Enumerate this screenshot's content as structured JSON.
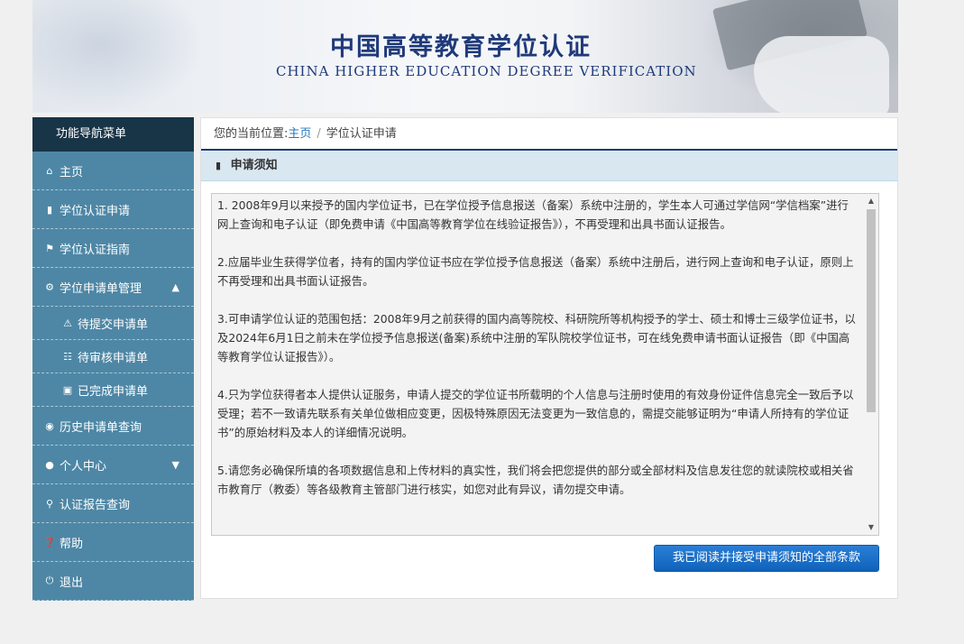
{
  "banner": {
    "title": "中国高等教育学位认证",
    "subtitle": "CHINA HIGHER EDUCATION DEGREE VERIFICATION"
  },
  "sidebar": {
    "header": "功能导航菜单",
    "items": [
      {
        "label": "主页",
        "icon": "home-icon"
      },
      {
        "label": "学位认证申请",
        "icon": "file-icon"
      },
      {
        "label": "学位认证指南",
        "icon": "bookmark-icon"
      },
      {
        "label": "学位申请单管理",
        "icon": "gear-icon",
        "expanded": true
      },
      {
        "label": "待提交申请单",
        "icon": "warning-icon"
      },
      {
        "label": "待审核申请单",
        "icon": "cart-icon"
      },
      {
        "label": "已完成申请单",
        "icon": "briefcase-icon"
      },
      {
        "label": "历史申请单查询",
        "icon": "camera-icon"
      },
      {
        "label": "个人中心",
        "icon": "user-icon",
        "expanded": false
      },
      {
        "label": "认证报告查询",
        "icon": "search-icon"
      },
      {
        "label": "帮助",
        "icon": "help-icon"
      },
      {
        "label": "退出",
        "icon": "power-icon"
      }
    ]
  },
  "breadcrumb": {
    "prefix": "您的当前位置:",
    "home": "主页",
    "separator": "/",
    "current": "学位认证申请"
  },
  "panel": {
    "title": "申请须知"
  },
  "notice": {
    "paragraphs": [
      "1. 2008年9月以来授予的国内学位证书，已在学位授予信息报送（备案）系统中注册的，学生本人可通过学信网“学信档案”进行网上查询和电子认证（即免费申请《中国高等教育学位在线验证报告》），不再受理和出具书面认证报告。",
      "2.应届毕业生获得学位者，持有的国内学位证书应在学位授予信息报送（备案）系统中注册后，进行网上查询和电子认证，原则上不再受理和出具书面认证报告。",
      "3.可申请学位认证的范围包括：2008年9月之前获得的国内高等院校、科研院所等机构授予的学士、硕士和博士三级学位证书，以及2024年6月1日之前未在学位授予信息报送(备案)系统中注册的军队院校学位证书，可在线免费申请书面认证报告（即《中国高等教育学位认证报告》）。",
      "4.只为学位获得者本人提供认证服务，申请人提交的学位证书所载明的个人信息与注册时使用的有效身份证件信息完全一致后予以受理；若不一致请先联系有关单位做相应变更，因极特殊原因无法变更为一致信息的，需提交能够证明为“申请人所持有的学位证书”的原始材料及本人的详细情况说明。",
      "5.请您务必确保所填的各项数据信息和上传材料的真实性，我们将会把您提供的部分或全部材料及信息发往您的就读院校或相关省市教育厅（教委）等各级教育主管部门进行核实，如您对此有异议，请勿提交申请。"
    ]
  },
  "agree_button": "我已阅读并接受申请须知的全部条款",
  "colors": {
    "sidebar_header": "#183447",
    "sidebar_item": "#4e87a5",
    "accent_blue": "#1c3b73",
    "button": "#1a6fc8"
  }
}
